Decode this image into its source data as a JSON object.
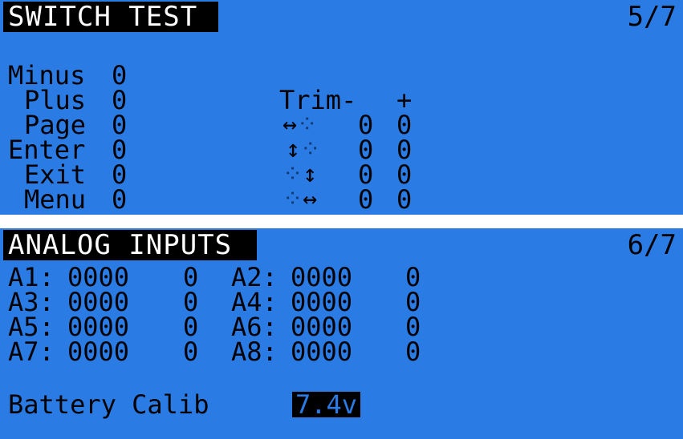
{
  "switch_test": {
    "title": "SWITCH TEST",
    "page": "5/7",
    "switches": [
      {
        "label": "Minus",
        "value": "0"
      },
      {
        "label": "Plus",
        "value": "0"
      },
      {
        "label": "Page",
        "value": "0"
      },
      {
        "label": "Enter",
        "value": "0"
      },
      {
        "label": "Exit",
        "value": "0"
      },
      {
        "label": "Menu",
        "value": "0"
      }
    ],
    "trim_header": {
      "label": "Trim-",
      "plus": "+"
    },
    "trims": [
      {
        "icon": "horizontal-arrow-dotted-icon",
        "minus": "0",
        "plus": "0"
      },
      {
        "icon": "vertical-arrow-dotted-icon",
        "minus": "0",
        "plus": "0"
      },
      {
        "icon": "dotted-vertical-arrow-icon",
        "minus": "0",
        "plus": "0"
      },
      {
        "icon": "dotted-horizontal-arrow-icon",
        "minus": "0",
        "plus": "0"
      }
    ]
  },
  "analog_inputs": {
    "title": "ANALOG INPUTS",
    "page": "6/7",
    "inputs": [
      {
        "label": "A1:",
        "raw": "0000",
        "val": "0"
      },
      {
        "label": "A2:",
        "raw": "0000",
        "val": "0"
      },
      {
        "label": "A3:",
        "raw": "0000",
        "val": "0"
      },
      {
        "label": "A4:",
        "raw": "0000",
        "val": "0"
      },
      {
        "label": "A5:",
        "raw": "0000",
        "val": "0"
      },
      {
        "label": "A6:",
        "raw": "0000",
        "val": "0"
      },
      {
        "label": "A7:",
        "raw": "0000",
        "val": "0"
      },
      {
        "label": "A8:",
        "raw": "0000",
        "val": "0"
      }
    ],
    "battery_label": "Battery Calib",
    "battery_value": "7.4v"
  },
  "colors": {
    "lcd_background": "#2b7be4",
    "text": "#000000",
    "title_bar": "#000000"
  }
}
